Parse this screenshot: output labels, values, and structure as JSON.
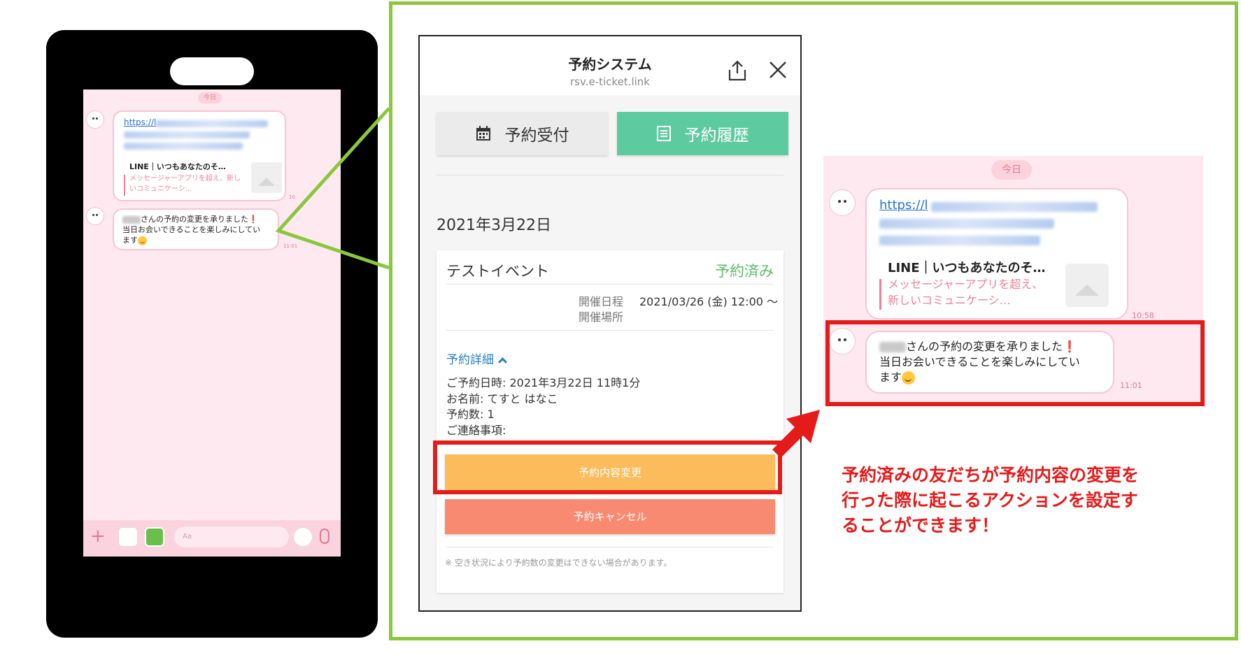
{
  "phone": {
    "date": "今日",
    "link_msg": {
      "url": "https://l",
      "card_title": "LINE｜いつもあなたのそ…",
      "card_desc": "メッセージャーアプリを超え、新しいコミュニケーシ…",
      "time": "10"
    },
    "reply_msg": {
      "line1": "さんの予約の変更を承りました",
      "excl": "❗",
      "line2": "当日お会いできることを楽しみにしてい",
      "line3": "ます",
      "time": "11:01"
    },
    "input_placeholder": "Aa"
  },
  "app": {
    "title": "予約システム",
    "domain": "rsv.e-ticket.link",
    "tabs": [
      {
        "label": "予約受付",
        "icon": "calendar-icon"
      },
      {
        "label": "予約履歴",
        "icon": "list-icon"
      }
    ],
    "date_heading": "2021年3月22日",
    "event": {
      "title": "テストイベント",
      "status": "予約済み",
      "schedule_label": "開催日程",
      "schedule_value": "2021/03/26 (金) 12:00 〜",
      "place_label": "開催場所",
      "detail_toggle": "予約詳細",
      "details": [
        "ご予約日時: 2021年3月22日 11時1分",
        "お名前: てすと はなこ",
        "予約数: 1",
        "ご連絡事項:"
      ],
      "change_button": "予約内容変更",
      "cancel_button": "予約キャンセル",
      "note": "※ 空き状況により予約数の変更はできない場合があります。"
    }
  },
  "zoom_chat": {
    "date": "今日",
    "url": "https://l",
    "card_title": "LINE｜いつもあなたのそ…",
    "card_desc": "メッセージャーアプリを超え、新しいコミュニケーシ…",
    "link_time": "10:58",
    "reply_line1": "さんの予約の変更を承りました",
    "reply_excl": "❗",
    "reply_line2": "当日お会いできることを楽しみにしてい",
    "reply_line3": "ます",
    "reply_time": "11:01"
  },
  "caption": {
    "line1": "予約済みの友だちが予約内容の変更を",
    "line2": "行った際に起こるアクションを設定す",
    "line3": "ることができます！"
  },
  "colors": {
    "green_frame": "#8cc63f",
    "highlight_red": "#e51a1a",
    "tab_active": "#5ecaa0",
    "change_button": "#fcbc5b",
    "cancel_button": "#f98a72",
    "status_green": "#5dbb6b",
    "chat_bg": "#fde9ef"
  }
}
